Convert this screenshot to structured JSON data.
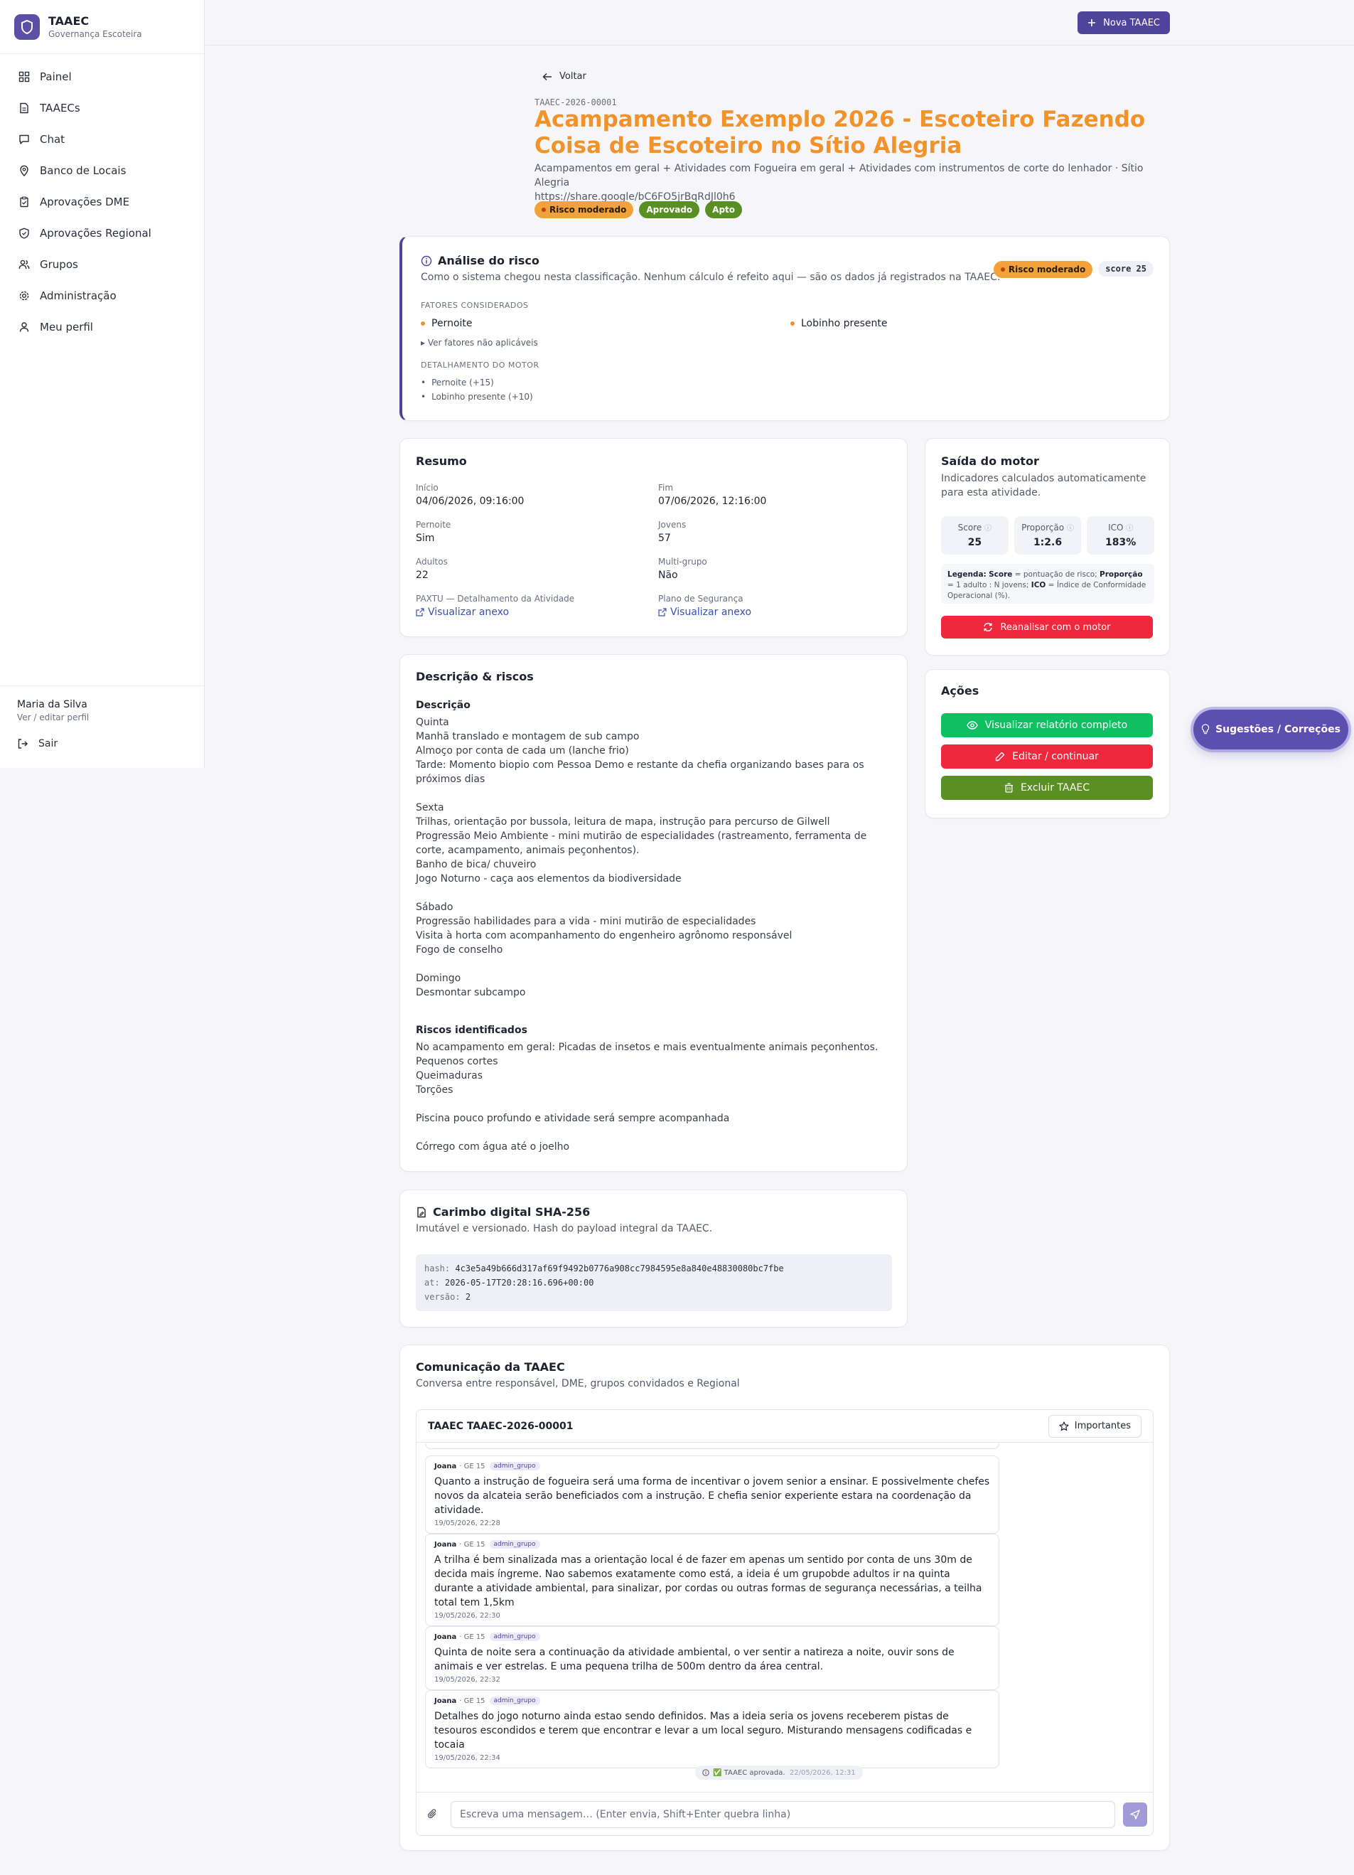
{
  "app": {
    "name": "TAAEC",
    "subtitle": "Governança Escoteira",
    "accent": "#4f449a",
    "title_color": "#f1922a"
  },
  "sidebar": {
    "items": [
      {
        "label": "Painel",
        "icon": "grid-icon"
      },
      {
        "label": "TAAECs",
        "icon": "document-icon"
      },
      {
        "label": "Chat",
        "icon": "chat-icon"
      },
      {
        "label": "Banco de Locais",
        "icon": "map-pin-icon"
      },
      {
        "label": "Aprovações DME",
        "icon": "clipboard-check-icon"
      },
      {
        "label": "Aprovações Regional",
        "icon": "shield-check-icon"
      },
      {
        "label": "Grupos",
        "icon": "users-icon"
      },
      {
        "label": "Administração",
        "icon": "gear-icon"
      },
      {
        "label": "Meu perfil",
        "icon": "user-icon"
      }
    ],
    "user": {
      "name": "Maria da Silva",
      "edit": "Ver / editar perfil",
      "logout": "Sair"
    }
  },
  "topbar": {
    "new_button": "Nova TAAEC"
  },
  "header": {
    "back": "Voltar",
    "code": "TAAEC-2026-00001",
    "title": "Acampamento Exemplo 2026 - Escoteiro Fazendo Coisa de Escoteiro no Sítio Alegria",
    "subtitle": "Acampamentos em geral + Atividades com Fogueira em geral + Atividades com instrumentos de corte do lenhador · Sítio Alegria",
    "url": "https://share.google/bC6FO5jrBqRdJl0h6",
    "badges": {
      "risk": "Risco moderado",
      "approved": "Aprovado",
      "apt": "Apto"
    }
  },
  "risk": {
    "title": "Análise do risco",
    "subtitle": "Como o sistema chegou nesta classificação. Nenhum cálculo é refeito aqui — são os dados já registrados na TAAEC.",
    "badge": "Risco moderado",
    "score": "score 25",
    "factors_label": "FATORES CONSIDERADOS",
    "factors": [
      "Pernoite",
      "Lobinho presente"
    ],
    "toggle": "▸ Ver fatores não aplicáveis",
    "motor_label": "DETALHAMENTO DO MOTOR",
    "motor_items": [
      "Pernoite (+15)",
      "Lobinho presente (+10)"
    ]
  },
  "resumo": {
    "title": "Resumo",
    "inicio_label": "Início",
    "inicio": "04/06/2026, 09:16:00",
    "fim_label": "Fim",
    "fim": "07/06/2026, 12:16:00",
    "pernoite_label": "Pernoite",
    "pernoite": "Sim",
    "jovens_label": "Jovens",
    "jovens": "57",
    "adultos_label": "Adultos",
    "adultos": "22",
    "multi_label": "Multi-grupo",
    "multi": "Não",
    "paxtu_label": "PAXTU — Detalhamento da Atividade",
    "plano_label": "Plano de Segurança",
    "link_text": "Visualizar anexo"
  },
  "motor": {
    "title": "Saída do motor",
    "subtitle": "Indicadores calculados automaticamente para esta atividade.",
    "metrics": [
      {
        "label": "Score",
        "value": "25"
      },
      {
        "label": "Proporção",
        "value": "1:2.6"
      },
      {
        "label": "ICO",
        "value": "183%"
      }
    ],
    "legend_prefix": "Legenda:",
    "legend_score": "Score",
    "legend_score_desc": " = pontuação de risco; ",
    "legend_prop": "Proporção",
    "legend_prop_desc": " = 1 adulto : N jovens; ",
    "legend_ico": "ICO",
    "legend_ico_desc": " = Índice de Conformidade Operacional (%).",
    "reanalyze": "Reanalisar com o motor"
  },
  "acoes": {
    "title": "Ações",
    "view": "Visualizar relatório completo",
    "edit": "Editar / continuar",
    "delete": "Excluir TAAEC"
  },
  "descricao": {
    "title": "Descrição & riscos",
    "desc_label": "Descrição",
    "desc_text": "Quinta\nManhã translado e montagem de sub campo\nAlmoço por conta de cada um (lanche frio)\nTarde: Momento biopio com Pessoa Demo e restante da chefia organizando bases para os próximos dias\n\nSexta\nTrilhas, orientação por bussola, leitura de mapa, instrução para percurso de Gilwell\nProgressão Meio Ambiente - mini mutirão de especialidades (rastreamento, ferramenta de corte, acampamento, animais peçonhentos).\nBanho de bica/ chuveiro\nJogo Noturno - caça aos elementos da biodiversidade\n\nSábado\nProgressão habilidades para a vida - mini mutirão de especialidades\nVisita à horta com acompanhamento do engenheiro agrônomo responsável\nFogo de conselho\n\nDomingo\nDesmontar subcampo",
    "risks_label": "Riscos identificados",
    "risks_text": "No acampamento em geral: Picadas de insetos e mais eventualmente animais peçonhentos.\nPequenos cortes\nQueimaduras\nTorções\n\nPiscina pouco profundo e atividade será sempre acompanhada\n\nCórrego com água até o joelho"
  },
  "hash": {
    "title": "Carimbo digital SHA-256",
    "subtitle": "Imutável e versionado. Hash do payload integral da TAAEC.",
    "hash_key": "hash:",
    "hash": "4c3e5a49b666d317af69f9492b0776a908cc7984595e8a840e48830080bc7fbe",
    "at_key": "at:",
    "at": "2026-05-17T20:28:16.696+00:00",
    "version_key": "versão:",
    "version": "2"
  },
  "chat": {
    "title": "Comunicação da TAAEC",
    "subtitle": "Conversa entre responsável, DME, grupos convidados e Regional",
    "thread": "TAAEC TAAEC-2026-00001",
    "important": "Importantes",
    "messages": [
      {
        "author": "Joana",
        "group": "· GE 15",
        "role": "admin_grupo",
        "text": "Quanto a instrução de fogueira será uma forma de incentivar o jovem senior a ensinar. E possivelmente chefes novos da alcateia serão beneficiados com a instrução.  E chefia senior experiente estara na coordenação da atividade.",
        "time": "19/05/2026, 22:28"
      },
      {
        "author": "Joana",
        "group": "· GE 15",
        "role": "admin_grupo",
        "text": "A trilha é bem sinalizada mas a orientação local é de fazer em apenas um sentido por conta de uns 30m de decida mais íngreme. Nao sabemos exatamente como está,  a ideia é um grupobde adultos ir na quinta durante a atividade ambiental, para sinalizar,  por cordas ou outras formas de segurança necessárias,  a teilha total tem 1,5km",
        "time": "19/05/2026, 22:30"
      },
      {
        "author": "Joana",
        "group": "· GE 15",
        "role": "admin_grupo",
        "text": "Quinta de noite sera a continuação da atividade ambiental,  o ver sentir a natireza a noite, ouvir sons de animais e ver estrelas. E uma pequena trilha de 500m dentro da área central.",
        "time": "19/05/2026, 22:32"
      },
      {
        "author": "Joana",
        "group": "· GE 15",
        "role": "admin_grupo",
        "text": "Detalhes do jogo noturno ainda estao sendo definidos. Mas a ideia seria os jovens receberem pistas de tesouros escondidos e terem que encontrar e levar a um local seguro. Misturando mensagens codificadas e tocaia",
        "time": "19/05/2026, 22:34"
      }
    ],
    "system_msg": "✅ TAAEC aprovada.",
    "system_time": "22/05/2026, 12:31",
    "placeholder": "Escreva uma mensagem… (Enter envia, Shift+Enter quebra linha)"
  },
  "fab": {
    "label": "Sugestões / Correções"
  }
}
